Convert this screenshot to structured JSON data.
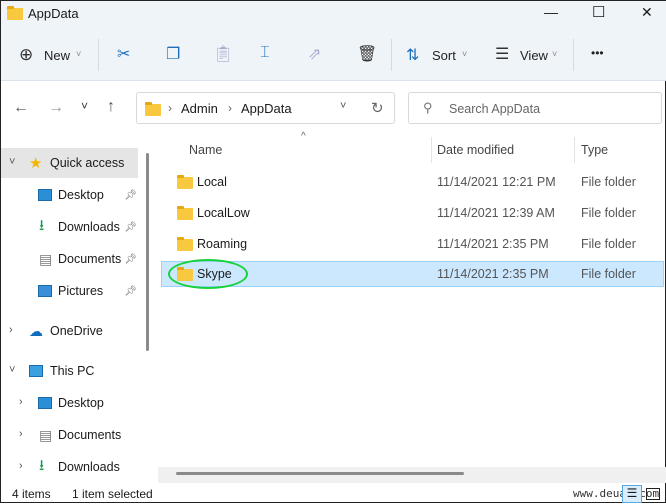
{
  "window": {
    "title": "AppData",
    "minimize": "—",
    "maximize": "☐",
    "close": "✕"
  },
  "toolbar": {
    "new_label": "New",
    "sort_label": "Sort",
    "view_label": "View",
    "more": "•••"
  },
  "nav": {
    "back": "←",
    "forward": "→",
    "recent": "˅",
    "up": "↑",
    "breadcrumb": [
      "Admin",
      "AppData"
    ],
    "refresh": "↻",
    "search_placeholder": "Search AppData"
  },
  "sidebar": {
    "quick_access": "Quick access",
    "quick_items": [
      {
        "label": "Desktop"
      },
      {
        "label": "Downloads"
      },
      {
        "label": "Documents"
      },
      {
        "label": "Pictures"
      }
    ],
    "onedrive": "OneDrive",
    "this_pc": "This PC",
    "pc_items": [
      {
        "label": "Desktop"
      },
      {
        "label": "Documents"
      },
      {
        "label": "Downloads"
      }
    ]
  },
  "columns": {
    "name": "Name",
    "date": "Date modified",
    "type": "Type"
  },
  "files": [
    {
      "name": "Local",
      "date": "11/14/2021 12:21 PM",
      "type": "File folder"
    },
    {
      "name": "LocalLow",
      "date": "11/14/2021 12:39 AM",
      "type": "File folder"
    },
    {
      "name": "Roaming",
      "date": "11/14/2021 2:35 PM",
      "type": "File folder"
    },
    {
      "name": "Skype",
      "date": "11/14/2021 2:35 PM",
      "type": "File folder",
      "selected": true
    }
  ],
  "status": {
    "count": "4 items",
    "selected": "1 item selected"
  },
  "watermark": "www.deuaq.com",
  "colors": {
    "selection": "#cce8ff",
    "highlight": "#18d23a",
    "accent": "#0067c0"
  }
}
